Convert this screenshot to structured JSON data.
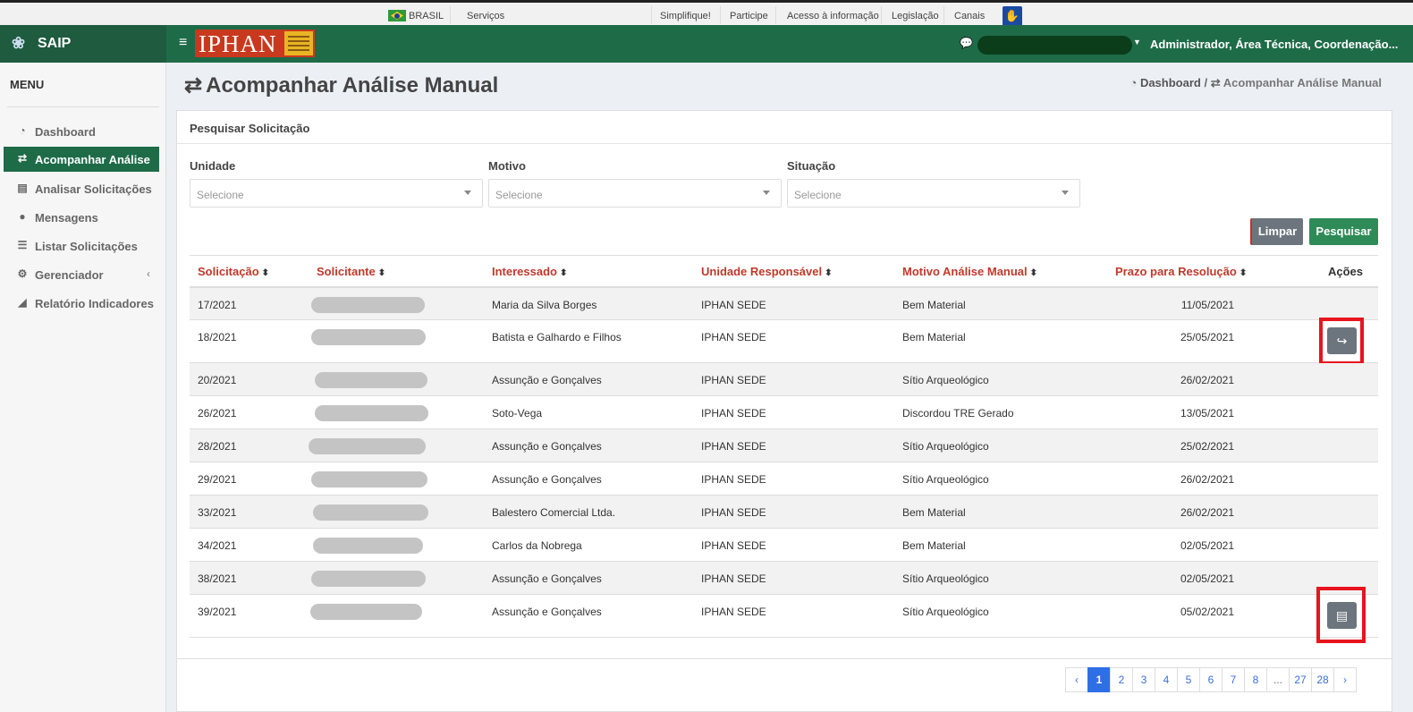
{
  "gov_bar": {
    "country": "BRASIL",
    "links": [
      "Serviços",
      "Simplifique!",
      "Participe",
      "Acesso à informação",
      "Legislação",
      "Canais"
    ]
  },
  "brand": {
    "name": "SAIP"
  },
  "header": {
    "logo_text": "IPHAN",
    "user_role": "Administrador, Área Técnica, Coordenação..."
  },
  "sidebar": {
    "menu_title": "MENU",
    "items": [
      {
        "label": "Dashboard",
        "icon": "dashboard-icon"
      },
      {
        "label": "Acompanhar Análise",
        "icon": "exchange-icon"
      },
      {
        "label": "Analisar Solicitações",
        "icon": "book-icon"
      },
      {
        "label": "Mensagens",
        "icon": "comments-icon"
      },
      {
        "label": "Listar Solicitações",
        "icon": "list-icon"
      },
      {
        "label": "Gerenciador",
        "icon": "cogs-icon"
      },
      {
        "label": "Relatório Indicadores",
        "icon": "area-chart-icon"
      }
    ]
  },
  "page": {
    "title": "Acompanhar Análise Manual",
    "breadcrumb": {
      "home": "Dashboard",
      "sep": "/",
      "current": "Acompanhar Análise Manual"
    }
  },
  "search": {
    "panel_title": "Pesquisar Solicitação",
    "filters": [
      {
        "label": "Unidade",
        "value": "Selecione"
      },
      {
        "label": "Motivo",
        "value": "Selecione"
      },
      {
        "label": "Situação",
        "value": "Selecione"
      }
    ],
    "clear_label": "Limpar",
    "search_label": "Pesquisar"
  },
  "table": {
    "columns": [
      "Solicitação",
      "Solicitante",
      "Interessado",
      "Unidade Responsável",
      "Motivo Análise Manual",
      "Prazo para Resolução",
      "Ações"
    ],
    "rows": [
      {
        "solicitacao": "17/2021",
        "interessado": "Maria da Silva Borges",
        "unidade": "IPHAN SEDE",
        "motivo": "Bem Material",
        "prazo": "11/05/2021",
        "action": ""
      },
      {
        "solicitacao": "18/2021",
        "interessado": "Batista e Galhardo e Filhos",
        "unidade": "IPHAN SEDE",
        "motivo": "Bem Material",
        "prazo": "25/05/2021",
        "action": "forward"
      },
      {
        "solicitacao": "20/2021",
        "interessado": "Assunção e Gonçalves",
        "unidade": "IPHAN SEDE",
        "motivo": "Sítio Arqueológico",
        "prazo": "26/02/2021",
        "action": ""
      },
      {
        "solicitacao": "26/2021",
        "interessado": "Soto-Vega",
        "unidade": "IPHAN SEDE",
        "motivo": "Discordou TRE Gerado",
        "prazo": "13/05/2021",
        "action": ""
      },
      {
        "solicitacao": "28/2021",
        "interessado": "Assunção e Gonçalves",
        "unidade": "IPHAN SEDE",
        "motivo": "Sítio Arqueológico",
        "prazo": "25/02/2021",
        "action": ""
      },
      {
        "solicitacao": "29/2021",
        "interessado": "Assunção e Gonçalves",
        "unidade": "IPHAN SEDE",
        "motivo": "Sítio Arqueológico",
        "prazo": "26/02/2021",
        "action": ""
      },
      {
        "solicitacao": "33/2021",
        "interessado": "Balestero Comercial Ltda.",
        "unidade": "IPHAN SEDE",
        "motivo": "Bem Material",
        "prazo": "26/02/2021",
        "action": ""
      },
      {
        "solicitacao": "34/2021",
        "interessado": "Carlos da Nobrega",
        "unidade": "IPHAN SEDE",
        "motivo": "Bem Material",
        "prazo": "02/05/2021",
        "action": ""
      },
      {
        "solicitacao": "38/2021",
        "interessado": "Assunção e Gonçalves",
        "unidade": "IPHAN SEDE",
        "motivo": "Sítio Arqueológico",
        "prazo": "02/05/2021",
        "action": ""
      },
      {
        "solicitacao": "39/2021",
        "interessado": "Assunção e Gonçalves",
        "unidade": "IPHAN SEDE",
        "motivo": "Sítio Arqueológico",
        "prazo": "05/02/2021",
        "action": "document"
      }
    ]
  },
  "pagination": {
    "prev": "‹",
    "pages": [
      "1",
      "2",
      "3",
      "4",
      "5",
      "6",
      "7",
      "8",
      "...",
      "27",
      "28"
    ],
    "next": "›",
    "current": "1"
  },
  "colors": {
    "header_green": "#1e6b48",
    "brand_green": "#1e5b3f",
    "sort_header_red": "#c0392b",
    "highlight_red": "#e8141e",
    "search_button": "#2e8b57",
    "clear_button": "#6c757d",
    "page_active": "#2f6fe6"
  }
}
